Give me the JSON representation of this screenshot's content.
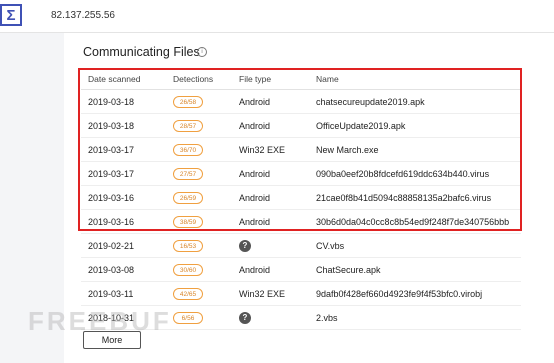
{
  "topbar": {
    "logo_icon": "sigma-icon",
    "search_value": "82.137.255.56"
  },
  "section": {
    "title": "Communicating Files",
    "info_icon": "info-icon"
  },
  "table": {
    "headers": {
      "date": "Date scanned",
      "detections": "Detections",
      "file_type": "File type",
      "name": "Name"
    },
    "rows": [
      {
        "date": "2019-03-18",
        "detections": "26/58",
        "file_type": "Android",
        "name": "chatsecureupdate2019.apk"
      },
      {
        "date": "2019-03-18",
        "detections": "28/57",
        "file_type": "Android",
        "name": "OfficeUpdate2019.apk"
      },
      {
        "date": "2019-03-17",
        "detections": "36/70",
        "file_type": "Win32 EXE",
        "name": "New March.exe"
      },
      {
        "date": "2019-03-17",
        "detections": "27/57",
        "file_type": "Android",
        "name": "090ba0eef20b8fdcefd619ddc634b440.virus"
      },
      {
        "date": "2019-03-16",
        "detections": "26/59",
        "file_type": "Android",
        "name": "21cae0f8b41d5094c88858135a2bafc6.virus"
      },
      {
        "date": "2019-03-16",
        "detections": "38/59",
        "file_type": "Android",
        "name": "30b6d0da04c0cc8c8b54ed9f248f7de340756bbb"
      },
      {
        "date": "2019-02-21",
        "detections": "16/53",
        "file_type": "",
        "file_type_icon": "question-icon",
        "name": "CV.vbs"
      },
      {
        "date": "2019-03-08",
        "detections": "30/60",
        "file_type": "Android",
        "name": "ChatSecure.apk"
      },
      {
        "date": "2019-03-11",
        "detections": "42/65",
        "file_type": "Win32 EXE",
        "name": "9dafb0f428ef660d4923fe9f4f53bfc0.virobj"
      },
      {
        "date": "2018-10-31",
        "detections": "6/56",
        "file_type": "",
        "file_type_icon": "question-icon",
        "name": "2.vbs"
      }
    ]
  },
  "more_button": {
    "label": "More"
  },
  "watermark": {
    "text": "FREEBUF"
  },
  "colors": {
    "accent": "#3f51b5",
    "highlight_border": "#e02222",
    "badge_border": "#f0a040",
    "badge_text": "#d8862a"
  }
}
